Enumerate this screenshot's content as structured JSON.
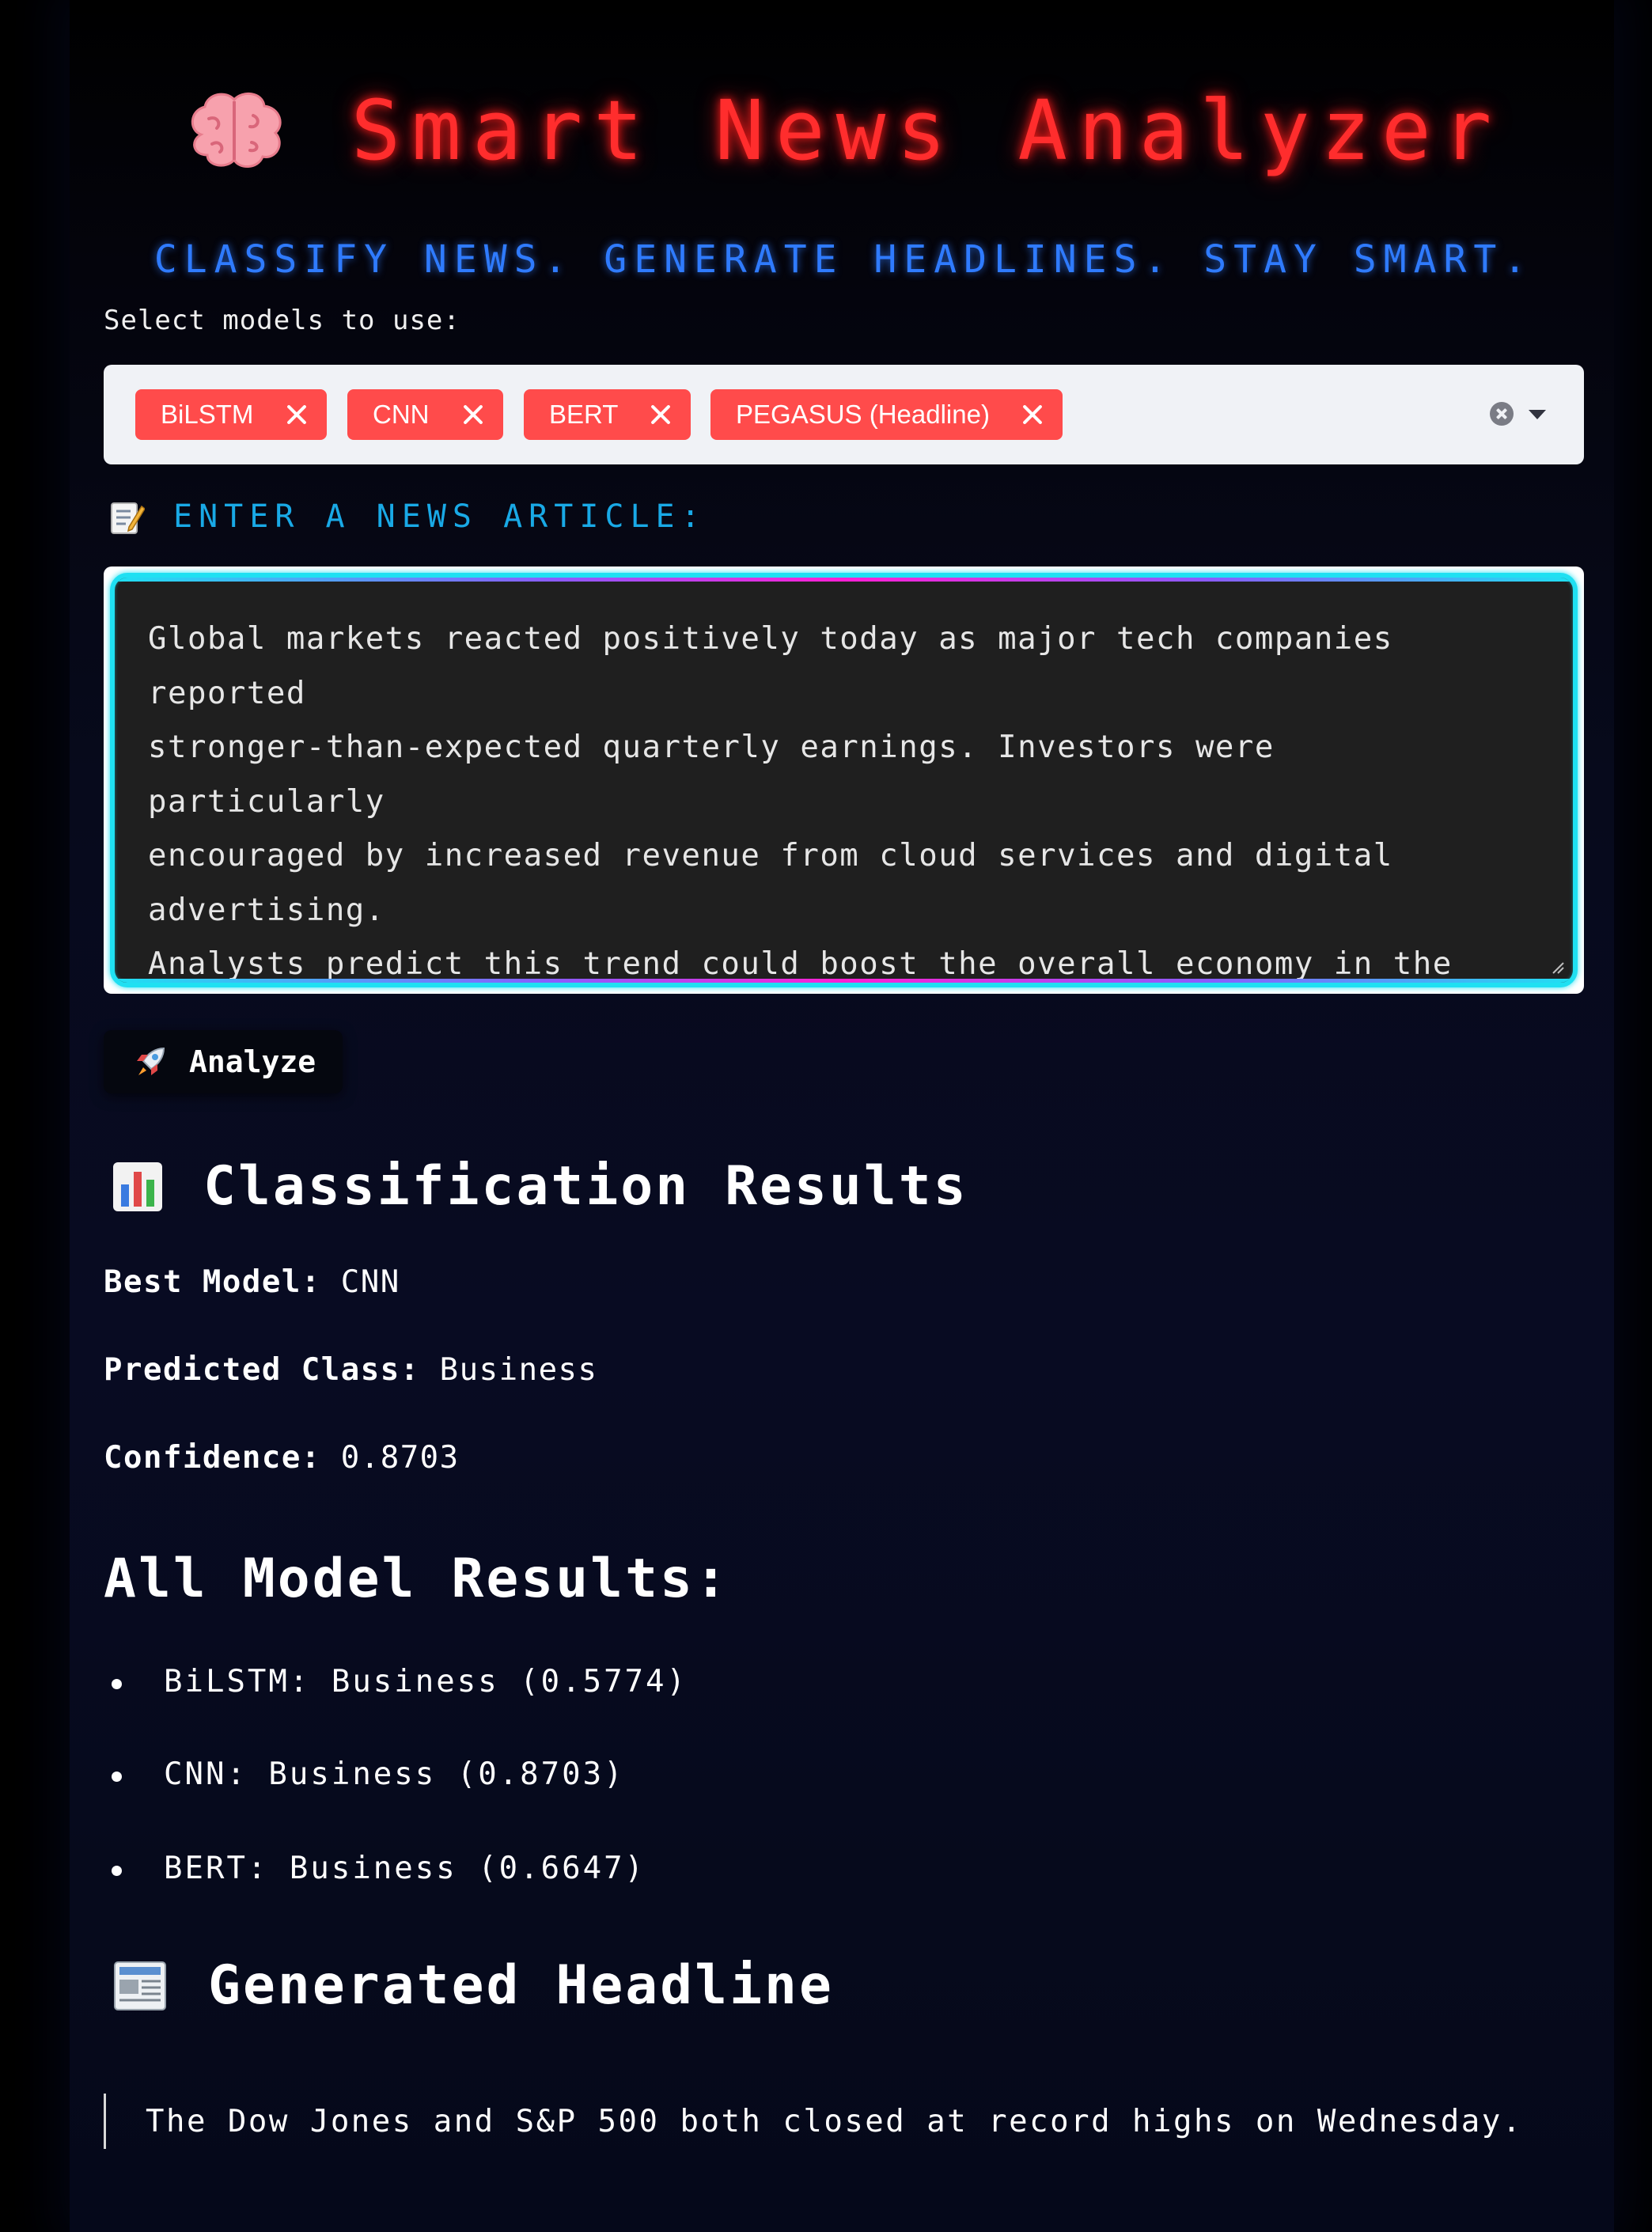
{
  "app": {
    "title": "Smart News Analyzer",
    "tagline": "CLASSIFY NEWS. GENERATE HEADLINES. STAY SMART.",
    "title_icon": "brain-icon"
  },
  "model_select": {
    "label": "Select models to use:",
    "selected": [
      "BiLSTM",
      "CNN",
      "BERT",
      "PEGASUS (Headline)"
    ],
    "chip_color": "#ff4b4b"
  },
  "article": {
    "label_icon": "memo-icon",
    "label": "ENTER A NEWS ARTICLE:",
    "value": "Global markets reacted positively today as major tech companies reported\nstronger-than-expected quarterly earnings. Investors were particularly\nencouraged by increased revenue from cloud services and digital advertising.\nAnalysts predict this trend could boost the overall economy in the coming\nmonths, signaling a robust recovery despite ongoing geopolitical tensions."
  },
  "analyze_button": {
    "icon": "rocket-icon",
    "label": "Analyze"
  },
  "classification": {
    "heading_icon": "bar-chart-icon",
    "heading": "Classification Results",
    "best_model_label": "Best Model:",
    "best_model": "CNN",
    "predicted_class_label": "Predicted Class:",
    "predicted_class": "Business",
    "confidence_label": "Confidence:",
    "confidence": "0.8703"
  },
  "all_results": {
    "heading": "All Model Results:",
    "items": [
      "BiLSTM: Business (0.5774)",
      "CNN: Business (0.8703)",
      "BERT: Business (0.6647)"
    ]
  },
  "headline": {
    "heading_icon": "newspaper-icon",
    "heading": "Generated Headline",
    "text": "The Dow Jones and S&P 500 both closed at record highs on Wednesday."
  },
  "colors": {
    "title_red": "#ff2d2d",
    "tagline_blue": "#2f7bff",
    "label_cyan": "#19a9e6",
    "textarea_border": "#1fe0f2"
  }
}
